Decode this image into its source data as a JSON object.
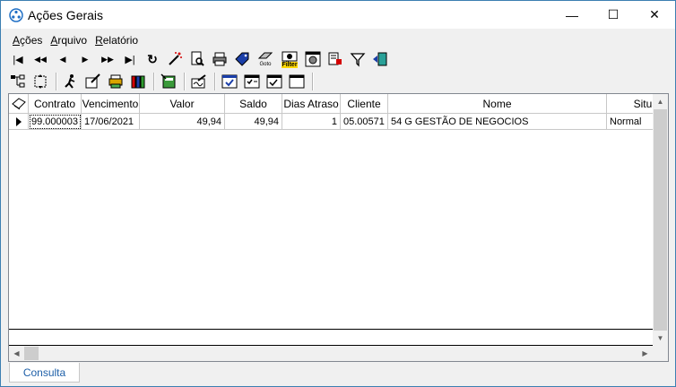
{
  "window": {
    "title": "Ações Gerais",
    "minimize": "—",
    "maximize": "☐",
    "close": "✕"
  },
  "menu": [
    {
      "label": "Ações",
      "underline": "A",
      "rest": "ções"
    },
    {
      "label": "Arquivo",
      "underline": "A",
      "rest": "rquivo"
    },
    {
      "label": "Relatório",
      "underline": "R",
      "rest": "elatório"
    }
  ],
  "toolbar1": {
    "first": "|◀",
    "prev_page": "◀◀",
    "prev": "◀",
    "next": "▶",
    "next_page": "▶▶",
    "last": "▶|",
    "refresh": "↻"
  },
  "goto_label": "Goto",
  "filter_label": "Filter",
  "grid": {
    "columns": [
      "Contrato",
      "Vencimento",
      "Valor",
      "Saldo",
      "Dias Atraso",
      "Cliente",
      "Nome",
      "Situa"
    ],
    "rows": [
      {
        "contrato": "99.000003",
        "vencimento": "17/06/2021",
        "valor": "49,94",
        "saldo": "49,94",
        "dias_atraso": "1",
        "cliente": "05.00571",
        "nome": "54 G GESTÃO DE NEGOCIOS",
        "situacao": "Normal"
      }
    ]
  },
  "tabs": {
    "active": "Consulta"
  }
}
